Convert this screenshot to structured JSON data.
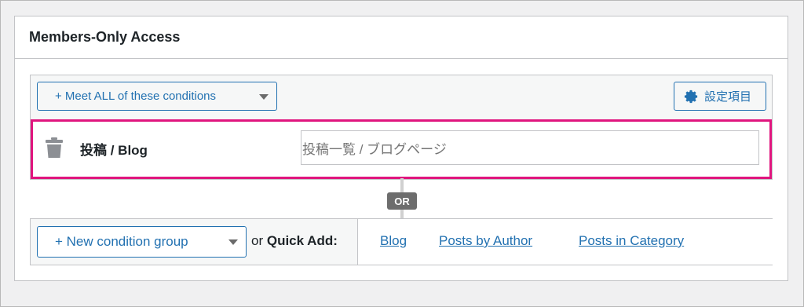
{
  "postbox": {
    "title": "Members-Only Access"
  },
  "group": {
    "meet_button_label": "+ Meet ALL of these conditions",
    "settings_button_label": "設定項目",
    "rule": {
      "label": "投稿 / Blog",
      "value": "投稿一覧 / ブログページ"
    }
  },
  "or_label": "OR",
  "add": {
    "new_group_label": "+ New condition group",
    "quick_add_prefix": "or",
    "quick_add_label": "Quick Add:",
    "links": [
      "Blog",
      "Posts by Author",
      "Posts in Category"
    ]
  },
  "colors": {
    "accent": "#2271b1",
    "highlight_border": "#e0157e",
    "or_badge": "#6d6d6d"
  },
  "icons": [
    "gear-icon",
    "trash-icon",
    "chevron-down-icon"
  ]
}
